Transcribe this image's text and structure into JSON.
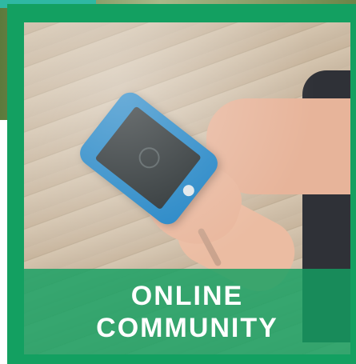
{
  "tile": {
    "caption_line1": "ONLINE",
    "caption_line2": "COMMUNITY",
    "accent_color": "#13a061",
    "image_subject": "hands holding phone",
    "icon": "phone-photo"
  }
}
